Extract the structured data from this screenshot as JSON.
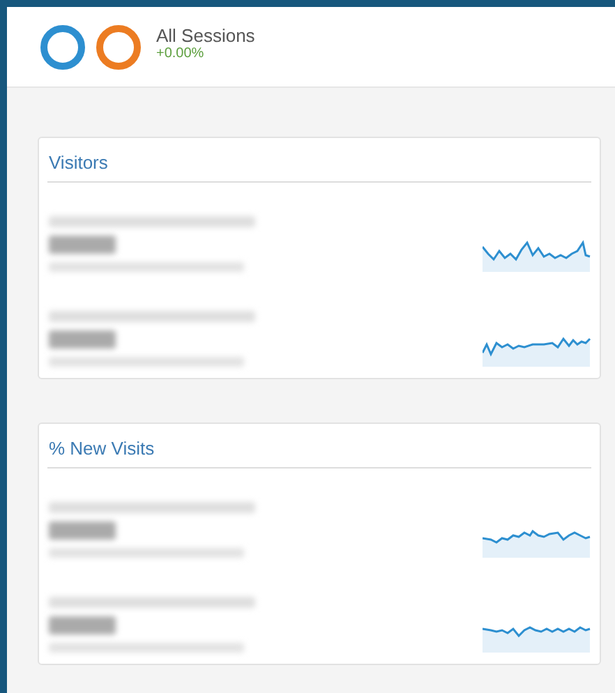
{
  "header": {
    "title": "All Sessions",
    "change": "+0.00%"
  },
  "cards": [
    {
      "title": "Visitors"
    },
    {
      "title": "% New Visits"
    }
  ]
}
